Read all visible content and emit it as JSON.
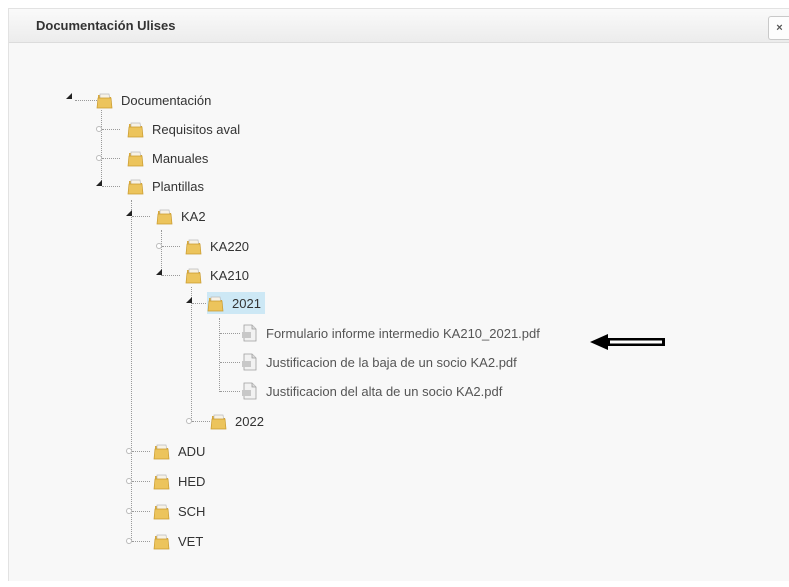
{
  "window": {
    "title": "Documentación Ulises",
    "close_label": "×"
  },
  "tree": {
    "root": "Documentación",
    "requisitos": "Requisitos aval",
    "manuales": "Manuales",
    "plantillas": "Plantillas",
    "ka2": "KA2",
    "ka220": "KA220",
    "ka210": "KA210",
    "y2021": "2021",
    "file1": "Formulario informe intermedio KA210_2021.pdf",
    "file2": "Justificacion de la baja de un socio KA2.pdf",
    "file3": "Justificacion del alta de un socio KA2.pdf",
    "y2022": "2022",
    "adu": "ADU",
    "hed": "HED",
    "sch": "SCH",
    "vet": "VET"
  },
  "icons": {
    "folder": "folder-icon",
    "file": "pdf-file-icon",
    "annotation": "left-arrow-icon",
    "folder_color": "#e8c25a",
    "selected_bg": "#cde8f5"
  }
}
